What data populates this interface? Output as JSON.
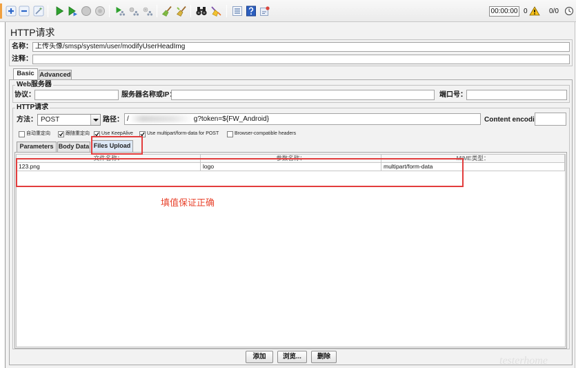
{
  "toolbar": {
    "buttons": [
      "expand-all-icon",
      "collapse-all-icon",
      "toggle-icon",
      "start-icon",
      "start-no-pauses-icon",
      "stop-icon",
      "shutdown-icon",
      "remote-start-all-icon",
      "remote-stop-all-icon",
      "remote-shutdown-all-icon",
      "clear-icon",
      "clear-all-icon",
      "search-icon",
      "reset-search-icon",
      "function-helper-icon",
      "help-icon",
      "plugins-manager-icon"
    ],
    "elapsed_time": "00:00:00",
    "error_count": "0",
    "active_threads": "0/0"
  },
  "sampler": {
    "title": "HTTP请求",
    "name_label": "名称：",
    "name_value": "上传头像/smsp/system/user/modifyUserHeadImg",
    "comment_label": "注释：",
    "comment_value": ""
  },
  "tabs": [
    {
      "label": "Basic",
      "selected": true
    },
    {
      "label": "Advanced",
      "selected": false
    }
  ],
  "web_server": {
    "group_label": "Web服务器",
    "protocol_label": "协议：",
    "protocol_value": "",
    "server_label": "服务器名称或IP：",
    "server_value": "",
    "port_label": "端口号：",
    "port_value": ""
  },
  "http_request": {
    "group_label": "HTTP请求",
    "method_label": "方法：",
    "method_value": "POST",
    "path_label": "路径：",
    "path_visible_prefix": "/",
    "path_visible_suffix": "g?token=${FW_Android}",
    "content_encoding_label": "Content encoding:",
    "content_encoding_value": "",
    "options": [
      {
        "label": "自动重定向",
        "checked": false
      },
      {
        "label": "跟随重定向",
        "checked": true
      },
      {
        "label": "Use KeepAlive",
        "checked": true
      },
      {
        "label": "Use multipart/form-data for POST",
        "checked": true
      },
      {
        "label": "Browser-compatible headers",
        "checked": false
      }
    ]
  },
  "subtabs": [
    {
      "label": "Parameters",
      "selected": false
    },
    {
      "label": "Body Data",
      "selected": false
    },
    {
      "label": "Files Upload",
      "selected": true
    }
  ],
  "files_upload": {
    "columns": [
      "文件名称：",
      "参数名称：",
      "MIME类型："
    ],
    "rows": [
      [
        "123.png",
        "logo",
        "multipart/form-data"
      ]
    ],
    "buttons": {
      "add": "添加",
      "browse": "浏览...",
      "delete": "删除"
    }
  },
  "annotation": {
    "text": "填值保证正确"
  },
  "watermark": "testerhome",
  "colors": {
    "highlight_box": "#e23c3c",
    "annotation_text": "#e8442e",
    "accent_orange": "#f0a040",
    "start_green": "#2ea02e",
    "warning_yellow": "#f7c21a"
  }
}
